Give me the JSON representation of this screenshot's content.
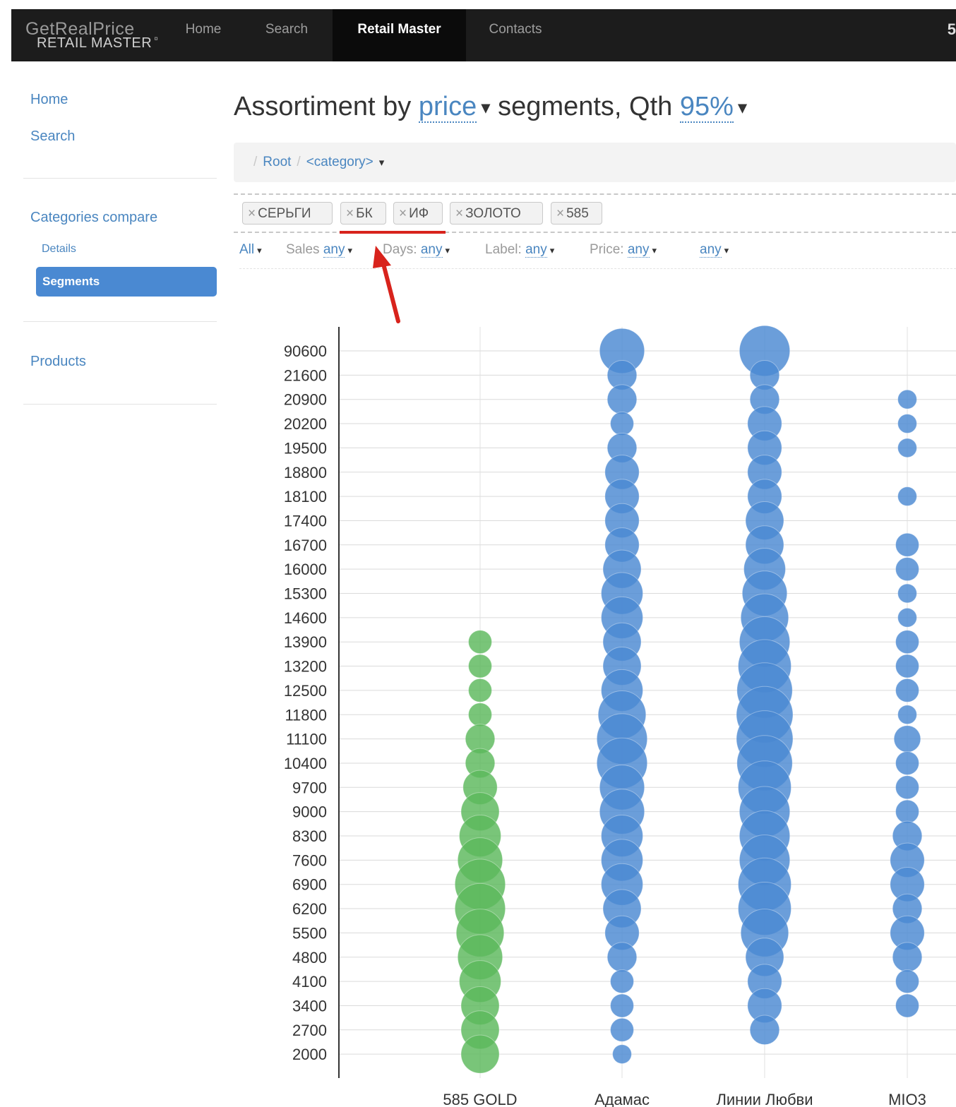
{
  "navbar": {
    "brand_top": "GetRealPrice",
    "brand_bottom": "RETAIL MASTER",
    "brand_sup": "¤",
    "items": [
      {
        "label": "Home"
      },
      {
        "label": "Search"
      },
      {
        "label": "Retail Master",
        "active": true
      },
      {
        "label": "Contacts"
      }
    ],
    "right_text": "5"
  },
  "sidebar": {
    "home": "Home",
    "search": "Search",
    "categories_compare": "Categories compare",
    "details": "Details",
    "segments": "Segments",
    "products": "Products"
  },
  "heading": {
    "prefix": "Assortiment by",
    "price_link": "price",
    "middle": "segments, Qth",
    "qth_link": "95%"
  },
  "breadcrumb": {
    "root": "Root",
    "category": "<category>"
  },
  "tags": [
    "СЕРЬГИ",
    "БК",
    "ИФ",
    "ЗОЛОТО",
    "585"
  ],
  "filters": {
    "all": "All",
    "sales_label": "Sales",
    "sales_value": "any",
    "days_label": "Days:",
    "days_value": "any",
    "label_label": "Label:",
    "label_value": "any",
    "price_label": "Price:",
    "price_value": "any",
    "last_value": "any"
  },
  "colors": {
    "accent": "#4a86c0",
    "green_series": "#5cb85c",
    "blue_series": "#4a89d2",
    "annotation_red": "#d8231c",
    "navbar_bg": "#1c1c1c"
  },
  "chart_data": {
    "type": "scatter",
    "categories": [
      "585 GOLD",
      "Адамас",
      "Линии Любви",
      "MIO3"
    ],
    "y_ticks": [
      "90600",
      "21600",
      "20900",
      "20200",
      "19500",
      "18800",
      "18100",
      "17400",
      "16700",
      "16000",
      "15300",
      "14600",
      "13900",
      "13200",
      "12500",
      "11800",
      "11100",
      "10400",
      "9700",
      "9000",
      "8300",
      "7600",
      "6900",
      "6200",
      "5500",
      "4800",
      "4100",
      "3400",
      "2700",
      "2000"
    ],
    "series": [
      {
        "category": "585 GOLD",
        "color": "green",
        "sizes": [
          0,
          0,
          0,
          0,
          0,
          0,
          0,
          0,
          0,
          0,
          0,
          0,
          1,
          1,
          1,
          1,
          2,
          2,
          3,
          4,
          5,
          6,
          8,
          8,
          7,
          6,
          5,
          4,
          4,
          4
        ]
      },
      {
        "category": "Адамас",
        "color": "blue",
        "sizes": [
          6,
          2,
          2,
          1,
          2,
          3,
          3,
          3,
          3,
          4,
          5,
          5,
          4,
          4,
          5,
          7,
          8,
          8,
          6,
          6,
          5,
          5,
          5,
          4,
          3,
          2,
          1,
          1,
          1,
          0.5
        ]
      },
      {
        "category": "Линии Любви",
        "color": "blue",
        "sizes": [
          8,
          2,
          2,
          3,
          3,
          3,
          3,
          4,
          4,
          5,
          6,
          7,
          8,
          9,
          10,
          11,
          11,
          10,
          9,
          8,
          8,
          8,
          9,
          9,
          7,
          4,
          3,
          3,
          2,
          0
        ]
      },
      {
        "category": "MIO3",
        "color": "blue",
        "sizes": [
          0,
          0,
          0.5,
          0.5,
          0.5,
          0,
          0.5,
          0,
          1,
          1,
          0.5,
          0.5,
          1,
          1,
          1,
          0.5,
          1.5,
          1,
          1,
          1,
          2,
          3,
          3,
          2,
          3,
          2,
          1,
          1,
          0,
          0
        ]
      }
    ],
    "legend": "none",
    "grid": true,
    "xlabel": "",
    "ylabel": ""
  }
}
